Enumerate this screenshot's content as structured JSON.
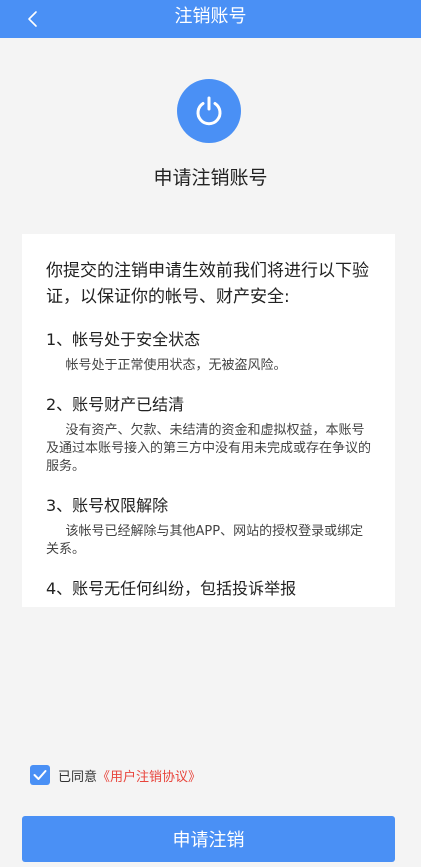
{
  "header": {
    "back_icon": "chevron-left-icon",
    "title": "注销账号"
  },
  "hero": {
    "icon": "power-icon",
    "title": "申请注销账号"
  },
  "card": {
    "intro": "你提交的注销申请生效前我们将进行以下验证，以保证你的帐号、财产安全:",
    "items": [
      {
        "title": "1、帐号处于安全状态",
        "desc": "帐号处于正常使用状态，无被盗风险。"
      },
      {
        "title": "2、账号财产已结清",
        "desc": "没有资产、欠款、未结清的资金和虚拟权益，本账号及通过本账号接入的第三方中没有用未完成或存在争议的服务。"
      },
      {
        "title": "3、账号权限解除",
        "desc": "该帐号已经解除与其他APP、网站的授权登录或绑定关系。"
      },
      {
        "title": "4、账号无任何纠纷，包括投诉举报"
      }
    ]
  },
  "agreement": {
    "checked": true,
    "text": "已同意",
    "link": "《用户注销协议》"
  },
  "submit": {
    "label": "申请注销"
  },
  "colors": {
    "accent": "#4a90f5",
    "link": "#e8453c",
    "background": "#f4f4f4"
  }
}
